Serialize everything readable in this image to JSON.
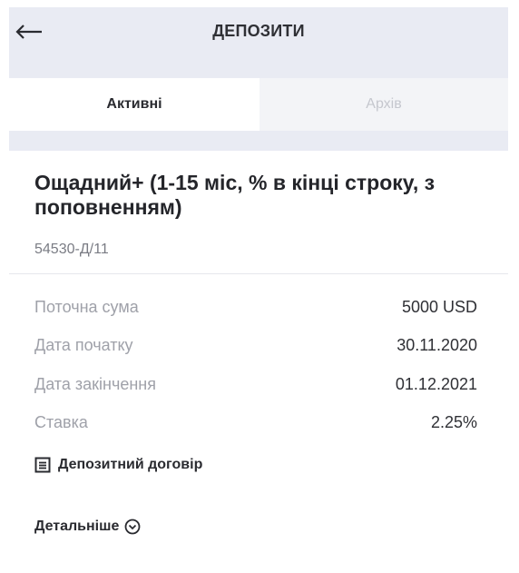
{
  "header": {
    "title": "ДЕПОЗИТИ",
    "back_icon": "arrow-left-icon"
  },
  "tabs": [
    {
      "label": "Активні",
      "active": true
    },
    {
      "label": "Архів",
      "active": false
    }
  ],
  "deposit": {
    "title": "Ощадний+ (1-15 міс, % в кінці строку, з поповненням)",
    "number": "54530-Д/11",
    "rows": [
      {
        "label": "Поточна сума",
        "value": "5000 USD"
      },
      {
        "label": "Дата початку",
        "value": "30.11.2020"
      },
      {
        "label": "Дата закінчення",
        "value": "01.12.2021"
      },
      {
        "label": "Ставка",
        "value": "2.25%"
      }
    ],
    "contract_link": {
      "label": "Депозитний договір",
      "icon": "document-icon"
    },
    "details_link": {
      "label": "Детальніше",
      "icon": "chevron-down-circle-icon"
    }
  },
  "colors": {
    "background": "#e9ebf3",
    "card": "#ffffff",
    "text_primary": "#2a2b30",
    "text_secondary": "#9fa1a9",
    "tab_inactive_text": "#c5c7ce"
  }
}
